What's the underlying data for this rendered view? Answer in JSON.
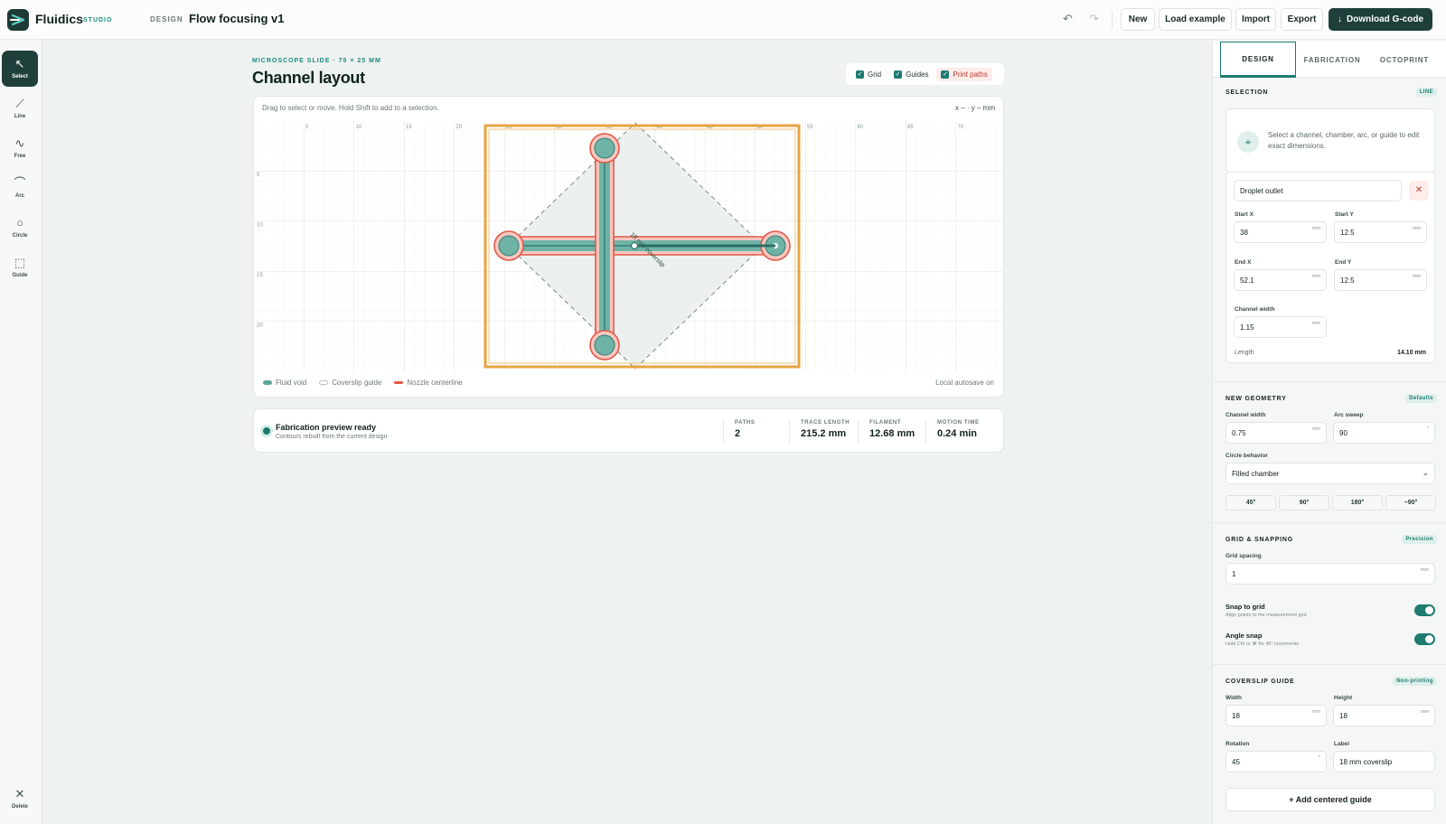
{
  "header": {
    "brand": "Fluidics",
    "brand_sub": "STUDIO",
    "crumb": "DESIGN",
    "title": "Flow focusing v1",
    "undo_icon": "undo-icon",
    "redo_icon": "redo-icon",
    "buttons": {
      "new": "New",
      "load": "Load example",
      "import": "Import",
      "export": "Export",
      "download": "Download G-code"
    }
  },
  "tools": [
    {
      "label": "Select",
      "icon": "↖"
    },
    {
      "label": "Line",
      "icon": "⟋"
    },
    {
      "label": "Free",
      "icon": "∿"
    },
    {
      "label": "Arc",
      "icon": "⌒"
    },
    {
      "label": "Circle",
      "icon": "○"
    },
    {
      "label": "Guide",
      "icon": "⬚"
    },
    {
      "label": "Delete",
      "icon": "✕"
    }
  ],
  "canvas": {
    "slide_label": "MICROSCOPE SLIDE · 75 × 25 MM",
    "title": "Channel layout",
    "toggles": {
      "grid": "Grid",
      "guides": "Guides",
      "print": "Print paths"
    },
    "hint": "Drag to select or move. Hold Shift to add to a selection.",
    "coords": "x – · y – mm",
    "x_ticks": [
      "5",
      "10",
      "15",
      "20",
      "25",
      "30",
      "35",
      "40",
      "45",
      "50",
      "55",
      "60",
      "65",
      "70"
    ],
    "y_ticks": [
      "5",
      "10",
      "15",
      "20"
    ],
    "guide_label": "18 mm coverslip",
    "legend": {
      "fluid": "Fluid void",
      "coverslip": "Coverslip guide",
      "nozzle": "Nozzle centerline"
    },
    "autosave": "Local autosave on",
    "colors": {
      "fluid": "#5fa79b",
      "coverslip_edge": "#e7a43f",
      "nozzle": "#e0584a",
      "grid": "#e6ebe9"
    }
  },
  "status": {
    "title": "Fabrication preview ready",
    "sub": "Contours rebuilt from the current design",
    "stats": [
      {
        "label": "PATHS",
        "value": "2"
      },
      {
        "label": "TRACE LENGTH",
        "value": "215.2 mm"
      },
      {
        "label": "FILAMENT",
        "value": "12.68 mm"
      },
      {
        "label": "MOTION TIME",
        "value": "0.24 min"
      }
    ]
  },
  "panel": {
    "tabs": [
      "DESIGN",
      "FABRICATION",
      "OCTOPRINT"
    ],
    "selection": {
      "title": "SELECTION",
      "badge": "LINE",
      "empty_text": "Select a channel, chamber, arc, or guide to edit exact dimensions.",
      "name": "Droplet outlet",
      "start_x_label": "Start X",
      "start_x": "38",
      "start_y_label": "Start Y",
      "start_y": "12.5",
      "end_x_label": "End X",
      "end_x": "52.1",
      "end_y_label": "End Y",
      "end_y": "12.5",
      "width_label": "Channel width",
      "width": "1.15",
      "length_label": "Length",
      "length": "14.10 mm",
      "unit": "mm"
    },
    "new_geometry": {
      "title": "NEW GEOMETRY",
      "badge": "Defaults",
      "width_label": "Channel width",
      "width": "0.75",
      "arc_label": "Arc sweep",
      "arc": "90",
      "arc_unit": "°",
      "circle_label": "Circle behavior",
      "circle": "Filled chamber",
      "angles": [
        "45°",
        "90°",
        "180°",
        "−90°"
      ]
    },
    "grid": {
      "title": "GRID & SNAPPING",
      "badge": "Precision",
      "spacing_label": "Grid spacing",
      "spacing": "1",
      "snap_title": "Snap to grid",
      "snap_sub": "Align points to the measurement grid",
      "angle_title": "Angle snap",
      "angle_sub": "Hold Ctrl or ⌘ for 45° increments"
    },
    "coverslip": {
      "title": "COVERSLIP GUIDE",
      "badge": "Non-printing",
      "width_label": "Width",
      "width": "18",
      "height_label": "Height",
      "height": "18",
      "rotation_label": "Rotation",
      "rotation": "45",
      "label_label": "Label",
      "label": "18 mm coverslip",
      "add": "+ Add centered guide"
    }
  }
}
